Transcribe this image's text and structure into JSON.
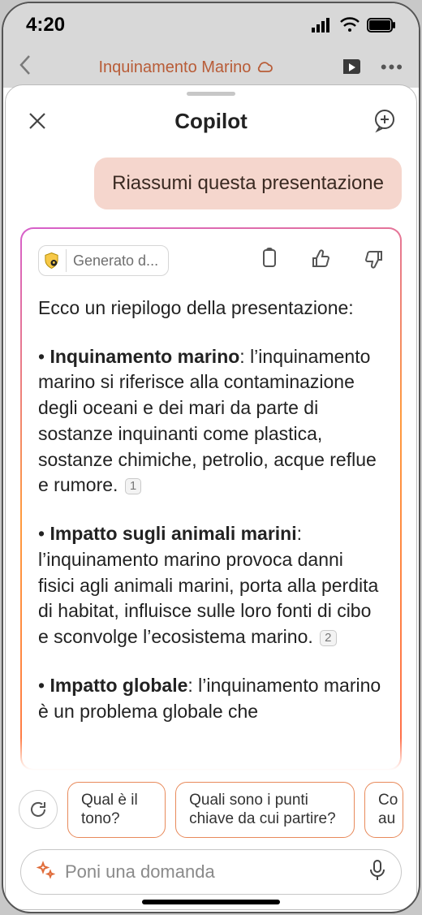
{
  "statusbar": {
    "time": "4:20"
  },
  "under": {
    "title": "Inquinamento Marino"
  },
  "sheet": {
    "title": "Copilot"
  },
  "chat": {
    "user_message": "Riassumi questa presentazione",
    "generated_badge": "Generato d...",
    "intro": "Ecco un riepilogo della presentazione:",
    "bullets": [
      {
        "title": "Inquinamento marino",
        "body": ": l’inquinamento marino si riferisce alla contaminazione degli oceani e dei mari da parte di sostanze inquinanti come plastica, sostanze chimiche, petrolio, acque reflue e rumore.",
        "cite": "1"
      },
      {
        "title": "Impatto sugli animali marini",
        "body": ": l’inquinamento marino provoca danni fisici agli animali marini, porta alla perdita di habitat, influisce sulle loro fonti di cibo e sconvolge l’ecosistema marino.",
        "cite": "2"
      },
      {
        "title": "Impatto globale",
        "body": ": l’inquinamento marino è un problema globale che",
        "cite": ""
      }
    ]
  },
  "suggestions": {
    "chips": [
      "Qual è il tono?",
      "Quali sono i punti chiave da cui partire?",
      "Co au"
    ]
  },
  "input": {
    "placeholder": "Poni una domanda"
  }
}
